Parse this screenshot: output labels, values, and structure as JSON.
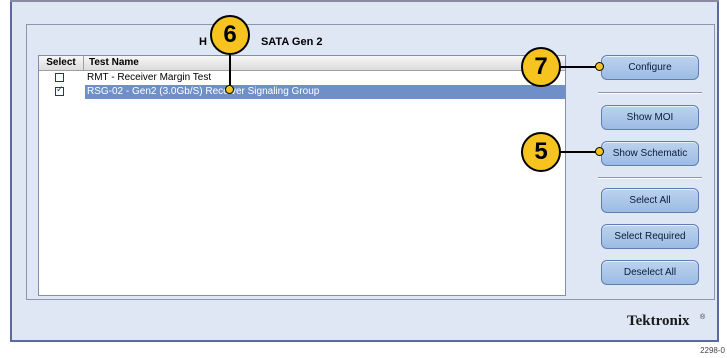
{
  "panel": {
    "title": "SATA Gen 2",
    "title_prefix": "H"
  },
  "table": {
    "headers": {
      "select": "Select",
      "test_name": "Test Name"
    },
    "rows": [
      {
        "checked": false,
        "name": "RMT - Receiver Margin Test"
      },
      {
        "checked": true,
        "name": "RSG-02 - Gen2 (3.0Gb/S) Receiver Signaling Group"
      }
    ]
  },
  "buttons": {
    "configure": "Configure",
    "show_moi": "Show MOI",
    "show_schematic": "Show Schematic",
    "select_all": "Select All",
    "select_required": "Select Required",
    "deselect_all": "Deselect All"
  },
  "callouts": {
    "c6": "6",
    "c7": "7",
    "c5": "5"
  },
  "brand": {
    "logo": "Tektronix",
    "mark": "®"
  },
  "figure_number": "2298-0",
  "colors": {
    "panel_bg": "#dfe7f5",
    "button_bg": "#a9c4e8",
    "selected_row": "#6f8fc8",
    "callout": "#f7c41f"
  }
}
